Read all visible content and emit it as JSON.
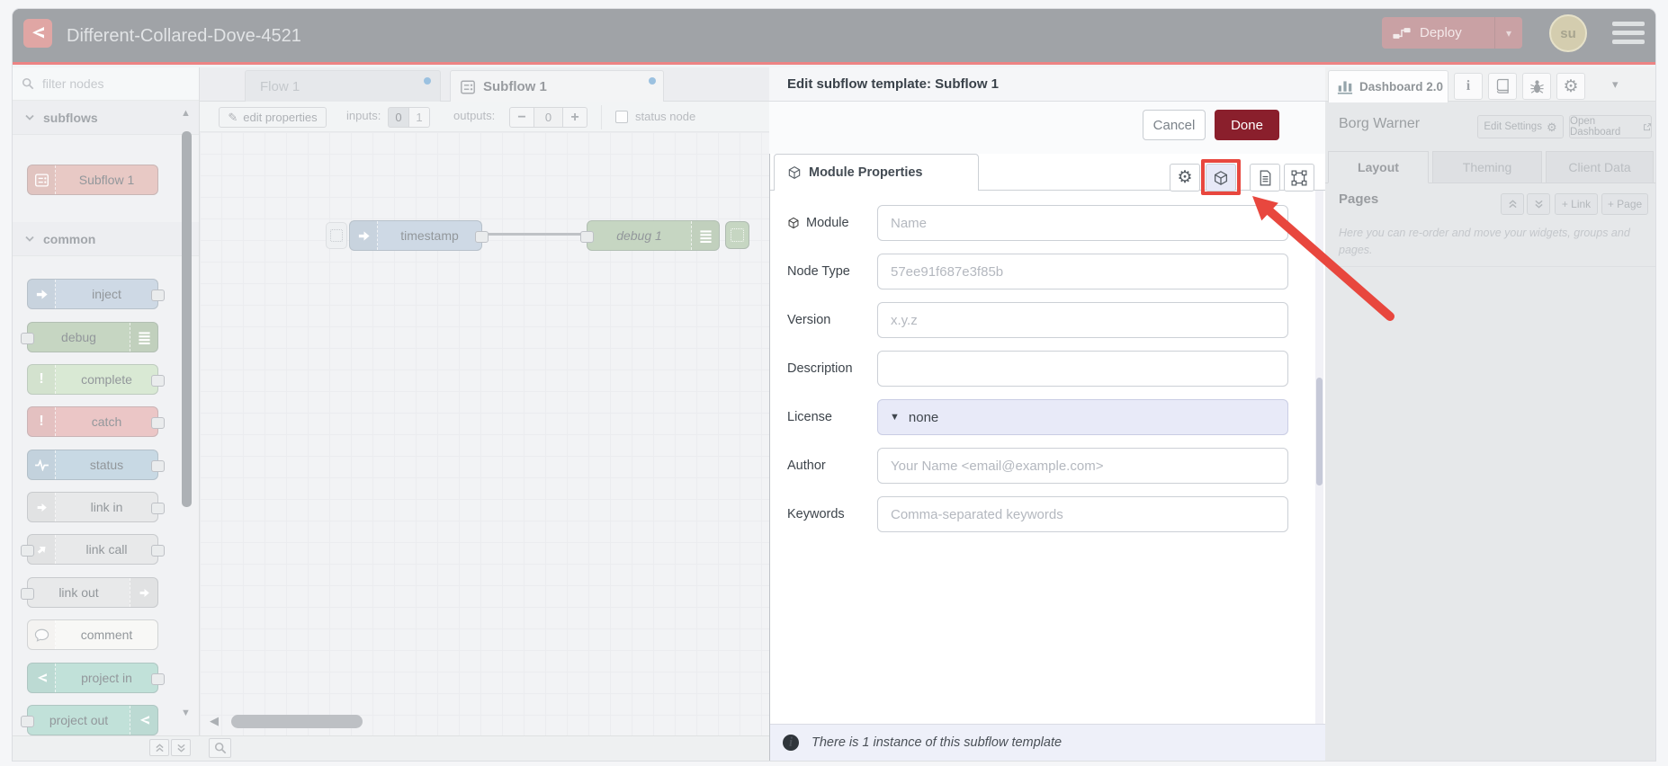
{
  "header": {
    "title": "Different-Collared-Dove-4521",
    "deploy_label": "Deploy",
    "avatar_initials": "su"
  },
  "palette": {
    "search_placeholder": "filter nodes",
    "categories": [
      {
        "label": "subflows",
        "items": [
          {
            "label": "Subflow 1"
          }
        ]
      },
      {
        "label": "common",
        "items": [
          {
            "label": "inject"
          },
          {
            "label": "debug"
          },
          {
            "label": "complete"
          },
          {
            "label": "catch"
          },
          {
            "label": "status"
          },
          {
            "label": "link in"
          },
          {
            "label": "link call"
          },
          {
            "label": "link out"
          },
          {
            "label": "comment"
          },
          {
            "label": "project in"
          },
          {
            "label": "project out"
          }
        ]
      }
    ],
    "node_colors": {
      "subflow": "#d7a09a",
      "inject": "#a9bdd1",
      "debug": "#9cb894",
      "complete": "#bdd9b4",
      "catch": "#dc9c9c",
      "status": "#9fbcd0",
      "link": "#d6d8da",
      "comment": "#f3f2ef",
      "project": "#93cbbd"
    }
  },
  "tabs": {
    "flow": "Flow 1",
    "subflow": "Subflow 1"
  },
  "subflow_toolbar": {
    "edit_properties": "edit properties",
    "inputs_label": "inputs:",
    "input_off": "0",
    "input_on": "1",
    "outputs_label": "outputs:",
    "minus": "−",
    "outputs_value": "0",
    "plus": "+",
    "status_node": "status node"
  },
  "canvas": {
    "nodes": [
      {
        "label": "timestamp"
      },
      {
        "label": "debug 1"
      }
    ]
  },
  "tray": {
    "title": "Edit subflow template: Subflow 1",
    "cancel": "Cancel",
    "done": "Done",
    "tab": "Module Properties",
    "fields": [
      {
        "label": "Module",
        "placeholder": "Name"
      },
      {
        "label": "Node Type",
        "placeholder": "57ee91f687e3f85b"
      },
      {
        "label": "Version",
        "placeholder": "x.y.z"
      },
      {
        "label": "Description",
        "placeholder": ""
      },
      {
        "label": "License",
        "value": "none"
      },
      {
        "label": "Author",
        "placeholder": "Your Name <email@example.com>"
      },
      {
        "label": "Keywords",
        "placeholder": "Comma-separated keywords"
      }
    ],
    "footer": "There is 1 instance of this subflow template"
  },
  "sidebar": {
    "tab": "Dashboard 2.0",
    "info_icon": "i",
    "owner": "Borg Warner",
    "edit_settings": "Edit Settings",
    "open_dashboard": "Open Dashboard",
    "tabs": [
      {
        "label": "Layout"
      },
      {
        "label": "Theming"
      },
      {
        "label": "Client Data"
      }
    ],
    "pages_title": "Pages",
    "add_link": "+ Link",
    "add_page": "+ Page",
    "help": "Here you can re-order and move your widgets, groups and pages."
  },
  "colors": {
    "header_bg": "#585e65",
    "accent_red": "#e02828",
    "deploy_bg": "#a15a60",
    "done_button": "#8a1f2c",
    "annotation": "#e8473e",
    "unsaved_dot": "#4f93c9"
  }
}
